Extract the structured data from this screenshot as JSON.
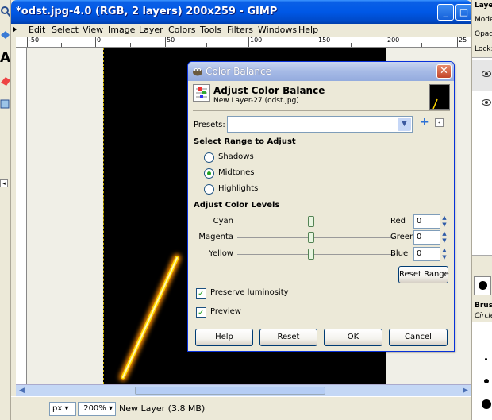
{
  "window": {
    "title": "*odst.jpg-4.0 (RGB, 2 layers) 200x259 - GIMP",
    "minimize_label": "_",
    "maximize_label": "□"
  },
  "menu": [
    "Edit",
    "Select",
    "View",
    "Image",
    "Layer",
    "Colors",
    "Tools",
    "Filters",
    "Windows",
    "Help"
  ],
  "ruler": {
    "labels": [
      "-50",
      "0",
      "50",
      "100",
      "150",
      "200",
      "25"
    ]
  },
  "status": {
    "unit": "px",
    "zoom": "200%",
    "text": "New Layer (3.8 MB)"
  },
  "dock": {
    "labels": [
      "Laye",
      "Mode",
      "Opac",
      "Lock:",
      "Brush",
      "Circle"
    ]
  },
  "dialog": {
    "title": "Color Balance",
    "close_label": "✕",
    "header_title": "Adjust Color Balance",
    "header_subtitle": "New Layer-27 (odst.jpg)",
    "presets_label": "Presets:",
    "presets_value": "",
    "range_heading": "Select Range to Adjust",
    "ranges": [
      {
        "label": "Shadows",
        "selected": false
      },
      {
        "label": "Midtones",
        "selected": true
      },
      {
        "label": "Highlights",
        "selected": false
      }
    ],
    "levels_heading": "Adjust Color Levels",
    "levels": [
      {
        "left": "Cyan",
        "right": "Red",
        "value": "0"
      },
      {
        "left": "Magenta",
        "right": "Green",
        "value": "0"
      },
      {
        "left": "Yellow",
        "right": "Blue",
        "value": "0"
      }
    ],
    "reset_range_label": "Reset Range",
    "preserve_luminosity": {
      "label": "Preserve luminosity",
      "checked": true
    },
    "preview": {
      "label": "Preview",
      "checked": true
    },
    "buttons": {
      "help": "Help",
      "reset": "Reset",
      "ok": "OK",
      "cancel": "Cancel"
    }
  },
  "colors": {
    "titlebar_blue": "#0058e6",
    "canvas_black": "#000000",
    "beam_yellow": "#ffd700",
    "dialog_bg": "#ece9d8"
  }
}
